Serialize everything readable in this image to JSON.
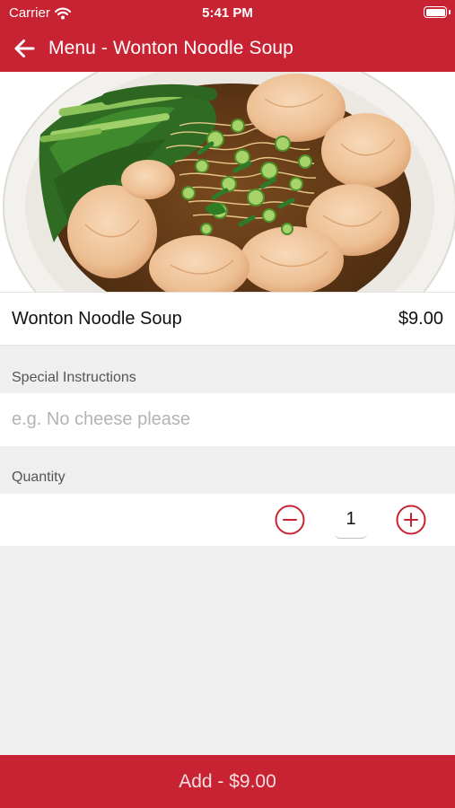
{
  "status_bar": {
    "carrier": "Carrier",
    "time": "5:41 PM"
  },
  "nav": {
    "title": "Menu - Wonton Noodle Soup"
  },
  "item": {
    "name": "Wonton Noodle Soup",
    "price": "$9.00"
  },
  "instructions": {
    "label": "Special Instructions",
    "placeholder": "e.g. No cheese please",
    "value": ""
  },
  "quantity": {
    "label": "Quantity",
    "value": "1"
  },
  "footer": {
    "add_label": "Add - $9.00"
  },
  "colors": {
    "brand_red": "#c82333",
    "background": "#efeff0"
  },
  "icons": {
    "back": "arrow-left-icon",
    "decrement": "minus-circle-icon",
    "increment": "plus-circle-icon",
    "wifi": "wifi-icon",
    "battery": "battery-icon"
  }
}
